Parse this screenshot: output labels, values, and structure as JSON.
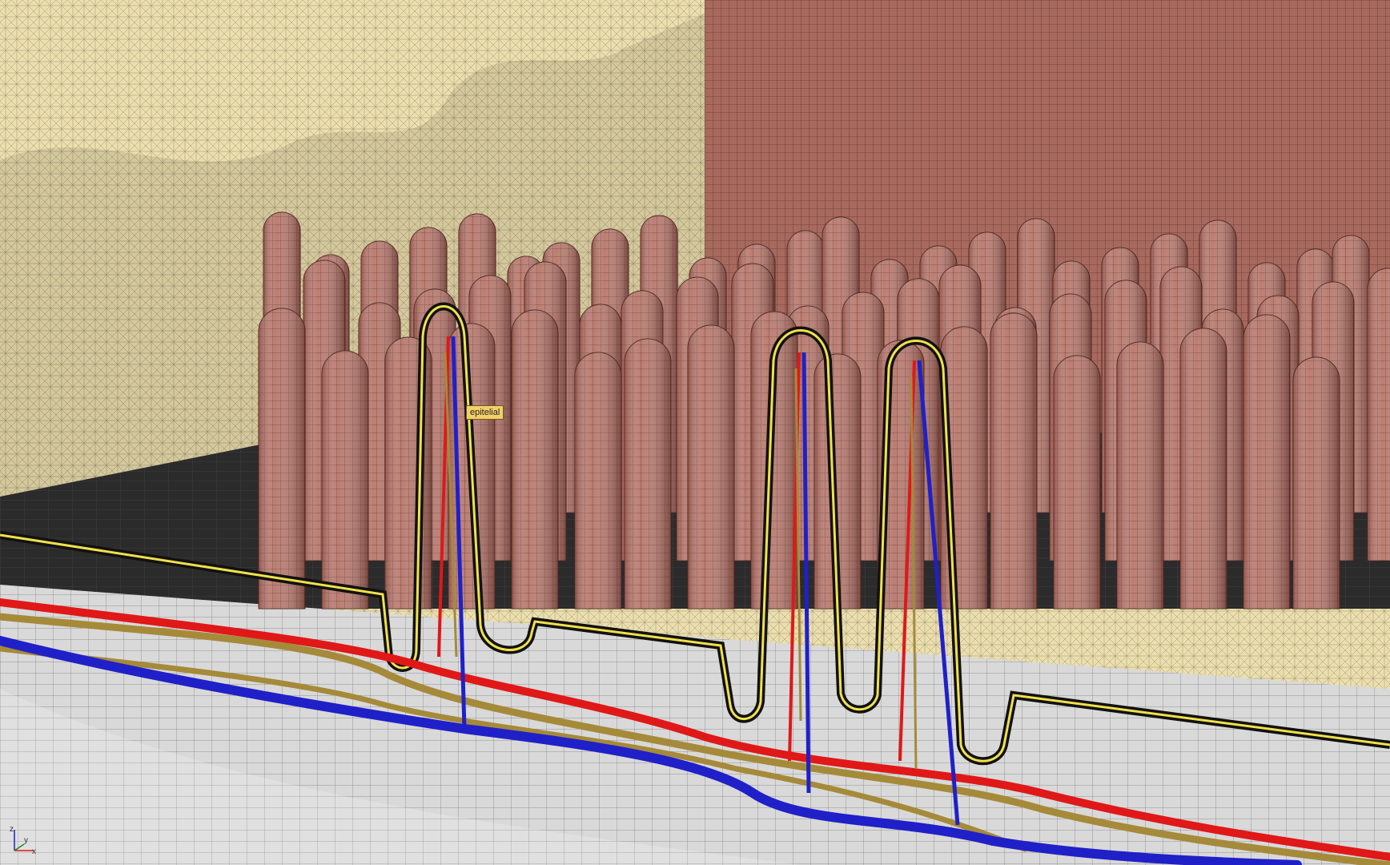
{
  "viewport": {
    "mode": "3d-wireframe-shaded",
    "selection_tooltip": "epitelial"
  },
  "axis_gizmo": {
    "x_label": "x",
    "y_label": "y",
    "z_label": "z"
  },
  "colors": {
    "background_mesh": "#ede0b0",
    "villi": "#b8766a",
    "villi_dark": "#8c5148",
    "floor_grid": "#d0d0d0",
    "dark_plane": "#2b2b2b",
    "selection_outline": "#f2e04a",
    "artery": "#e01818",
    "vein": "#2020c8",
    "lymphatic": "#a58a3a"
  }
}
